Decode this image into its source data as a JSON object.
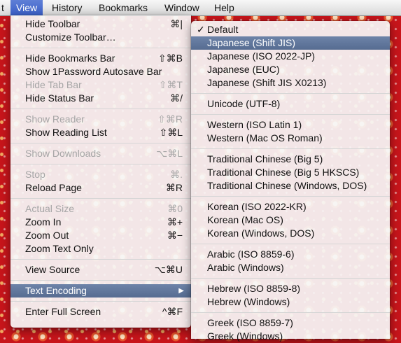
{
  "menubar": {
    "items": [
      "t",
      "View",
      "History",
      "Bookmarks",
      "Window",
      "Help"
    ]
  },
  "view_menu": {
    "items": [
      {
        "label": "Hide Toolbar",
        "shortcut": "⌘|"
      },
      {
        "label": "Customize Toolbar…",
        "shortcut": ""
      },
      {
        "label": "Hide Bookmarks Bar",
        "shortcut": "⇧⌘B"
      },
      {
        "label": "Show 1Password Autosave Bar",
        "shortcut": ""
      },
      {
        "label": "Hide Tab Bar",
        "shortcut": "⇧⌘T"
      },
      {
        "label": "Hide Status Bar",
        "shortcut": "⌘/"
      },
      {
        "label": "Show Reader",
        "shortcut": "⇧⌘R"
      },
      {
        "label": "Show Reading List",
        "shortcut": "⇧⌘L"
      },
      {
        "label": "Show Downloads",
        "shortcut": "⌥⌘L"
      },
      {
        "label": "Stop",
        "shortcut": "⌘."
      },
      {
        "label": "Reload Page",
        "shortcut": "⌘R"
      },
      {
        "label": "Actual Size",
        "shortcut": "⌘0"
      },
      {
        "label": "Zoom In",
        "shortcut": "⌘+"
      },
      {
        "label": "Zoom Out",
        "shortcut": "⌘−"
      },
      {
        "label": "Zoom Text Only",
        "shortcut": ""
      },
      {
        "label": "View Source",
        "shortcut": "⌥⌘U"
      },
      {
        "label": "Text Encoding",
        "shortcut": ""
      },
      {
        "label": "Enter Full Screen",
        "shortcut": "^⌘F"
      }
    ]
  },
  "encoding_menu": {
    "checkmark": "✓",
    "items": [
      "Default",
      "Japanese (Shift JIS)",
      "Japanese (ISO 2022-JP)",
      "Japanese (EUC)",
      "Japanese (Shift JIS X0213)",
      "Unicode (UTF-8)",
      "Western (ISO Latin 1)",
      "Western (Mac OS Roman)",
      "Traditional Chinese (Big 5)",
      "Traditional Chinese (Big 5 HKSCS)",
      "Traditional Chinese (Windows, DOS)",
      "Korean (ISO 2022-KR)",
      "Korean (Mac OS)",
      "Korean (Windows, DOS)",
      "Arabic (ISO 8859-6)",
      "Arabic (Windows)",
      "Hebrew (ISO 8859-8)",
      "Hebrew (Windows)",
      "Greek (ISO 8859-7)",
      "Greek (Windows)"
    ]
  },
  "colors": {
    "menubar_highlight": "#3a5fc8",
    "item_highlight": "#566c91",
    "background": "#c8151b"
  },
  "icons": {
    "submenu_arrow": "▶",
    "check": "checkmark-icon"
  }
}
